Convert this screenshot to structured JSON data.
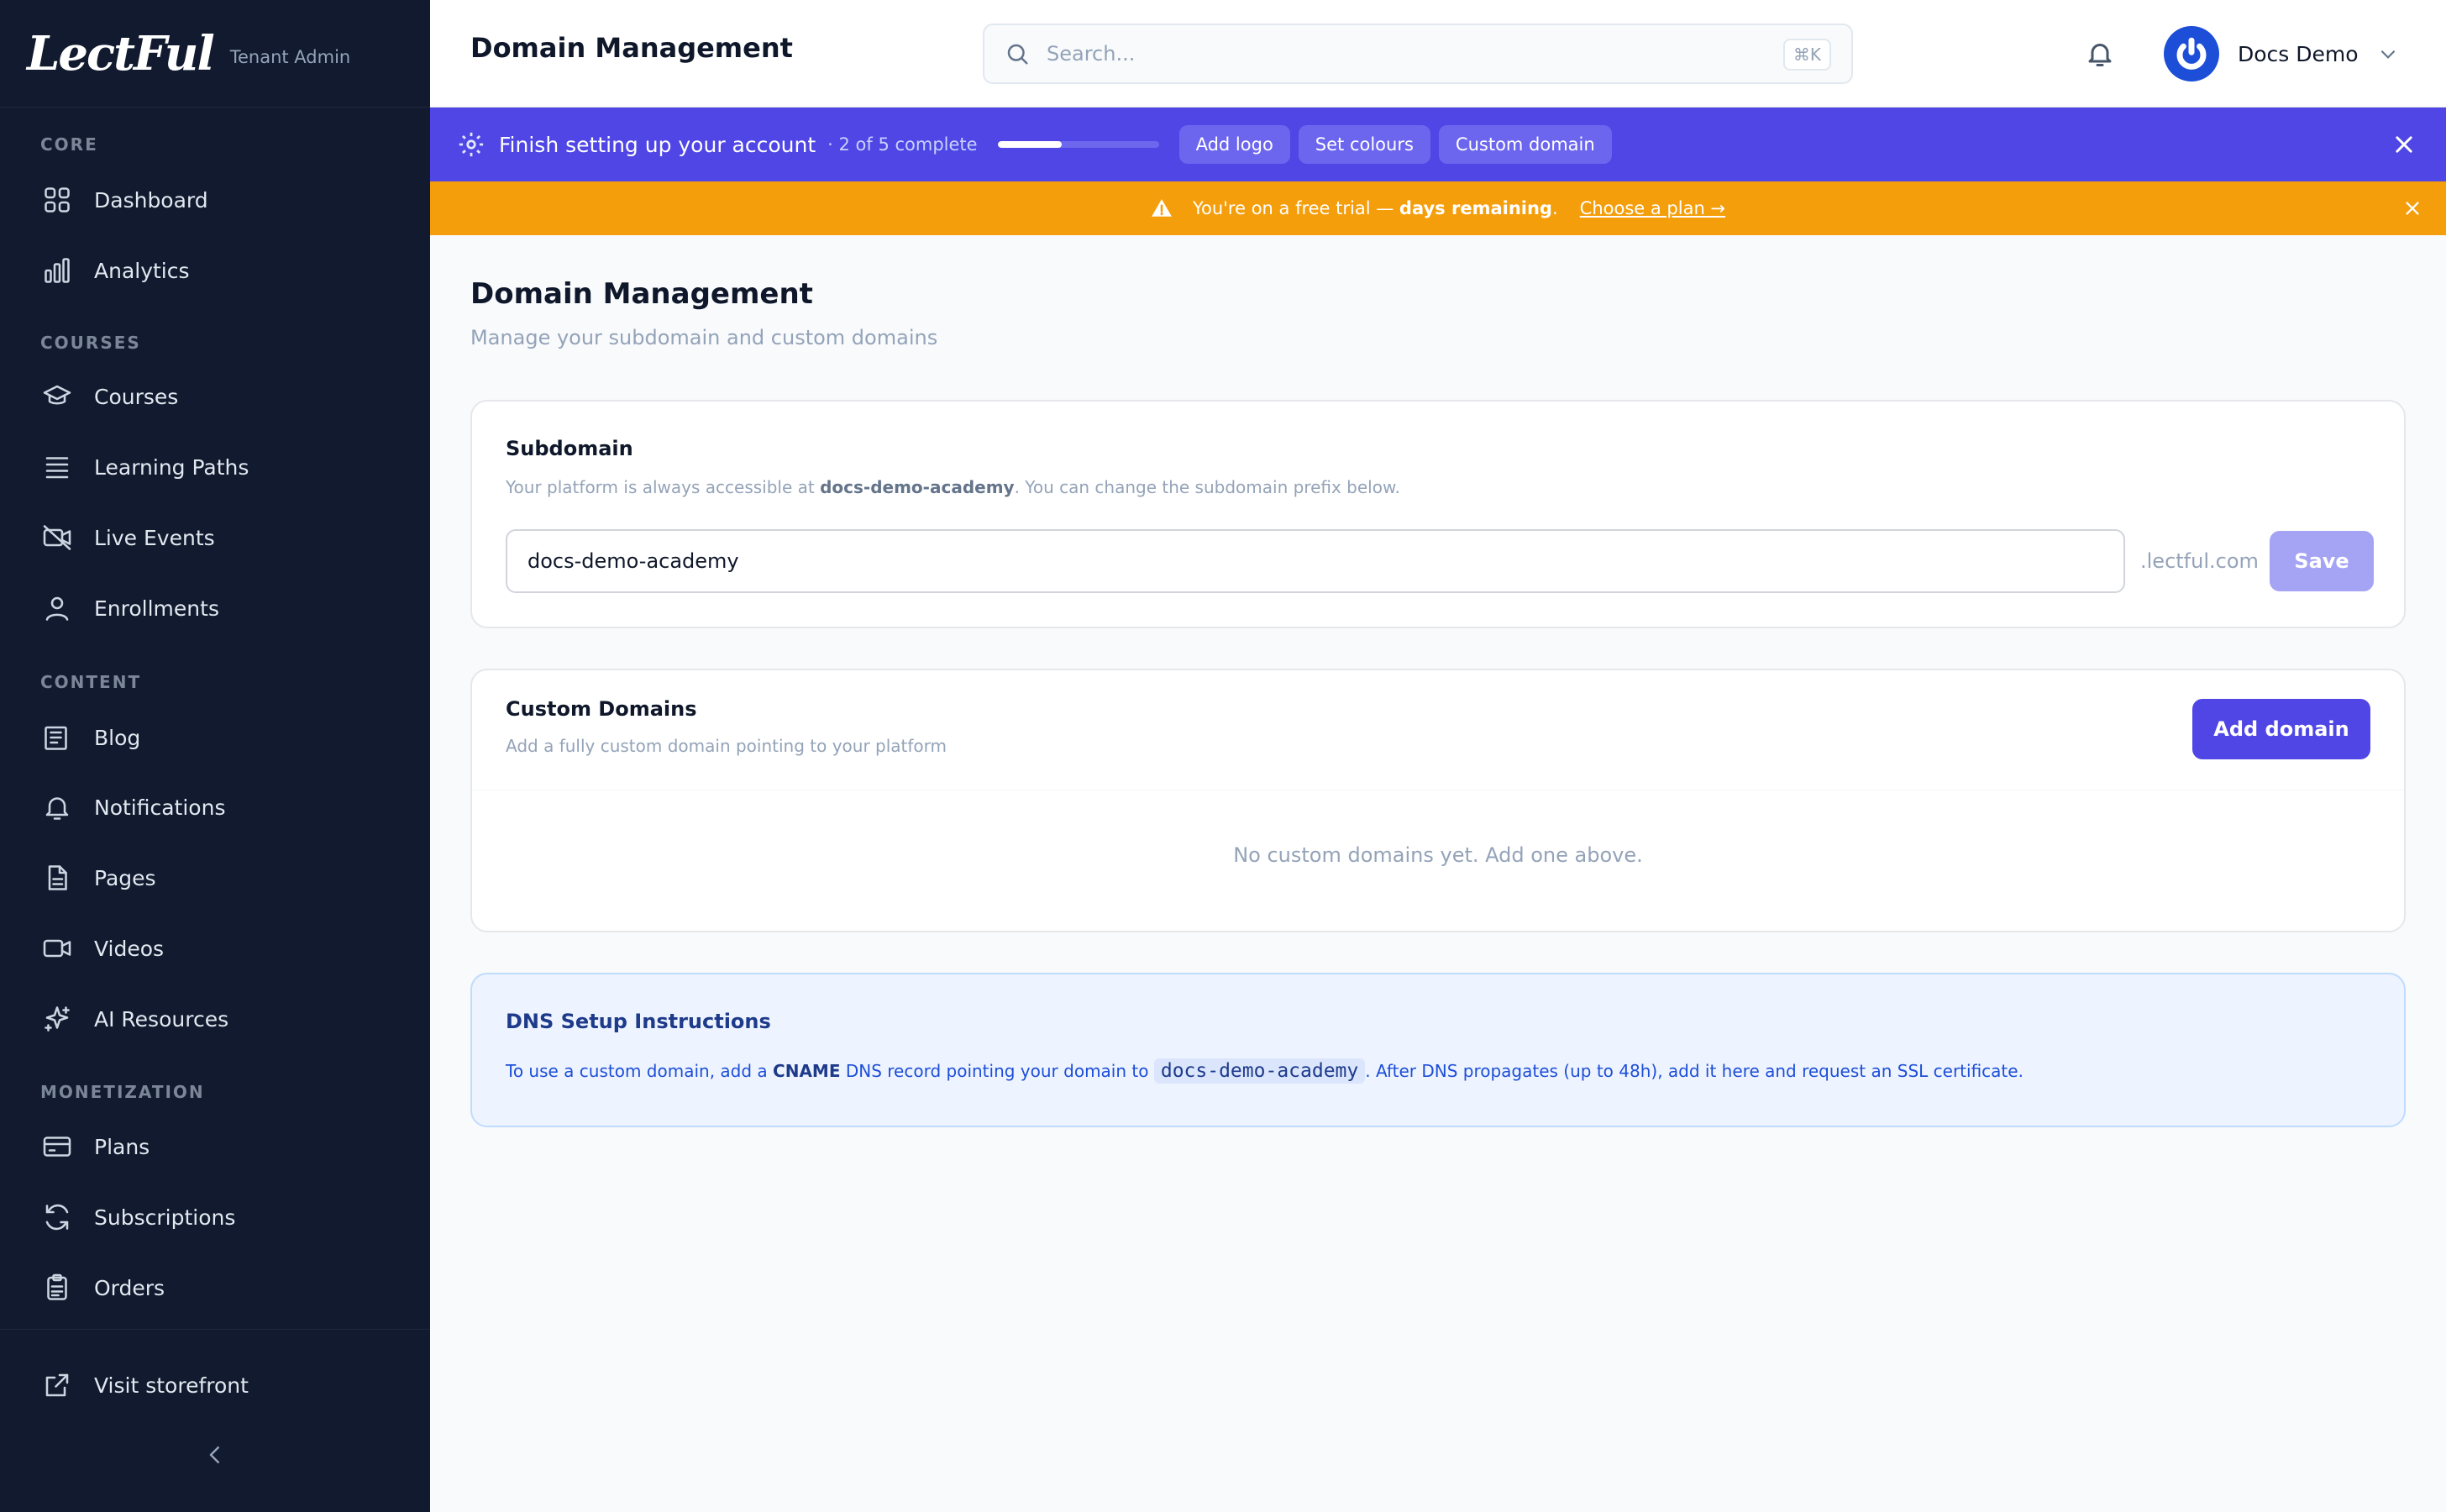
{
  "brand": {
    "logo": "LectFul",
    "subtitle": "Tenant Admin"
  },
  "sidebar": {
    "sections": [
      {
        "label": "CORE"
      },
      {
        "label": "COURSES"
      },
      {
        "label": "CONTENT"
      },
      {
        "label": "MONETIZATION"
      }
    ],
    "items": [
      {
        "label": "Dashboard",
        "icon": "grid-icon"
      },
      {
        "label": "Analytics",
        "icon": "bar-chart-icon"
      },
      {
        "label": "Courses",
        "icon": "graduation-cap-icon"
      },
      {
        "label": "Learning Paths",
        "icon": "list-icon"
      },
      {
        "label": "Live Events",
        "icon": "video-off-icon"
      },
      {
        "label": "Enrollments",
        "icon": "user-icon"
      },
      {
        "label": "Blog",
        "icon": "newspaper-icon"
      },
      {
        "label": "Notifications",
        "icon": "bell-icon"
      },
      {
        "label": "Pages",
        "icon": "file-icon"
      },
      {
        "label": "Videos",
        "icon": "video-icon"
      },
      {
        "label": "AI Resources",
        "icon": "sparkles-icon"
      },
      {
        "label": "Plans",
        "icon": "credit-card-icon"
      },
      {
        "label": "Subscriptions",
        "icon": "refresh-icon"
      },
      {
        "label": "Orders",
        "icon": "clipboard-icon"
      }
    ],
    "footer": {
      "visit_label": "Visit storefront"
    }
  },
  "header": {
    "title": "Domain Management",
    "search_placeholder": "Search...",
    "search_shortcut": "⌘K",
    "user_name": "Docs Demo"
  },
  "setup_banner": {
    "title": "Finish setting up your account",
    "count": "· 2 of 5 complete",
    "progress": 0.4,
    "chips": [
      "Add logo",
      "Set colours",
      "Custom domain"
    ]
  },
  "trial_banner": {
    "prefix": "You're on a free trial —",
    "bold": "days remaining",
    "suffix": ".",
    "link": "Choose a plan →"
  },
  "page": {
    "title": "Domain Management",
    "subtitle": "Manage your subdomain and custom domains"
  },
  "subdomain": {
    "title": "Subdomain",
    "desc_prefix": "Your platform is always accessible at",
    "desc_bold": "docs-demo-academy",
    "desc_suffix": ". You can change the subdomain prefix below.",
    "value": "docs-demo-academy",
    "suffix": ".lectful.com",
    "save_label": "Save"
  },
  "custom_domains": {
    "title": "Custom Domains",
    "desc": "Add a fully custom domain pointing to your platform",
    "add_label": "Add domain",
    "empty": "No custom domains yet. Add one above."
  },
  "dns": {
    "title": "DNS Setup Instructions",
    "text_1": "To use a custom domain, add a",
    "record": "CNAME",
    "text_2": "DNS record pointing your domain to",
    "target": "docs-demo-academy",
    "text_3": ". After DNS propagates (up to 48h), add it here and request an SSL certificate."
  },
  "colors": {
    "sidebar_bg": "#111a2e",
    "accent": "#4f46e5",
    "warning": "#f59e0b"
  }
}
